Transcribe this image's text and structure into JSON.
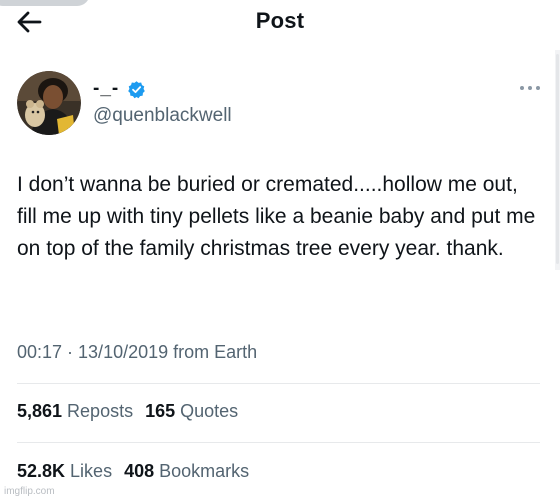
{
  "header": {
    "title": "Post"
  },
  "author": {
    "display_name": "-_-",
    "handle": "@quenblackwell",
    "verified": true,
    "avatar_icon": "profile-photo",
    "accent_color": "#1d9bf0"
  },
  "post": {
    "text": "I don’t wanna be buried or cremated.....hollow me out, fill me up with tiny pellets like a beanie baby and put me on top of the family christmas tree every year. thank.",
    "meta": "00:17 · 13/10/2019 from Earth"
  },
  "stats": {
    "reposts_count": "5,861",
    "reposts_label": "Reposts",
    "quotes_count": "165",
    "quotes_label": "Quotes",
    "likes_count": "52.8K",
    "likes_label": "Likes",
    "bookmarks_count": "408",
    "bookmarks_label": "Bookmarks"
  },
  "watermark": "imgflip.com"
}
